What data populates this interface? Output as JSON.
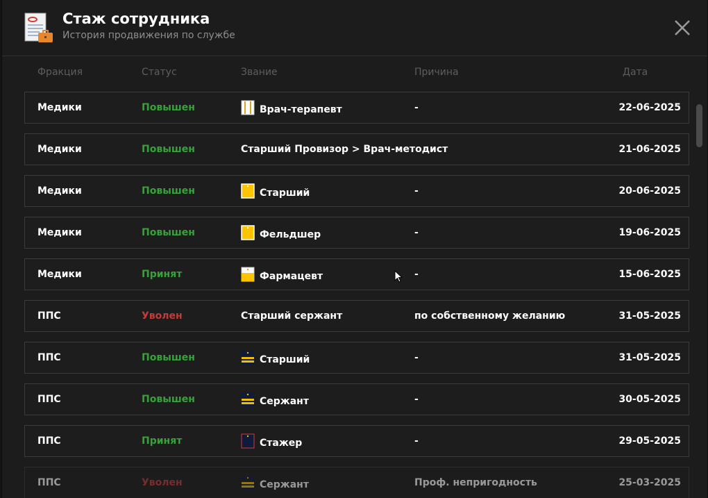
{
  "header": {
    "title": "Стаж сотрудника",
    "subtitle": "История продвижения по службе"
  },
  "columns": {
    "faction": "Фракция",
    "status": "Статус",
    "rank": "Звание",
    "reason": "Причина",
    "date": "Дата"
  },
  "rows": [
    {
      "faction": "Медики",
      "status": "Повышен",
      "status_type": "up",
      "rank": "Врач-терапевт",
      "rank_icon": "medic-white",
      "reason": "-",
      "date": "22-06-2025"
    },
    {
      "faction": "Медики",
      "status": "Повышен",
      "status_type": "up",
      "rank": "Старший Провизор > Врач-методист",
      "rank_icon": "",
      "reason": "",
      "date": "21-06-2025"
    },
    {
      "faction": "Медики",
      "status": "Повышен",
      "status_type": "up",
      "rank": "Старший",
      "rank_icon": "medic-yellow",
      "reason": "-",
      "date": "20-06-2025"
    },
    {
      "faction": "Медики",
      "status": "Повышен",
      "status_type": "up",
      "rank": "Фельдшер",
      "rank_icon": "medic-yellow",
      "reason": "-",
      "date": "19-06-2025"
    },
    {
      "faction": "Медики",
      "status": "Принят",
      "status_type": "up",
      "rank": "Фармацевт",
      "rank_icon": "medic-yellow-white",
      "reason": "-",
      "date": "15-06-2025"
    },
    {
      "faction": "ППС",
      "status": "Уволен",
      "status_type": "fired",
      "rank": "Старший сержант",
      "rank_icon": "",
      "reason": "по собственному желанию",
      "date": "31-05-2025"
    },
    {
      "faction": "ППС",
      "status": "Повышен",
      "status_type": "up",
      "rank": "Старший",
      "rank_icon": "police-stripes",
      "reason": "-",
      "date": "31-05-2025"
    },
    {
      "faction": "ППС",
      "status": "Повышен",
      "status_type": "up",
      "rank": "Сержант",
      "rank_icon": "police-stripes",
      "reason": "-",
      "date": "30-05-2025"
    },
    {
      "faction": "ППС",
      "status": "Принят",
      "status_type": "up",
      "rank": "Стажер",
      "rank_icon": "police-plain",
      "reason": "-",
      "date": "29-05-2025"
    },
    {
      "faction": "ППС",
      "status": "Уволен",
      "status_type": "fired",
      "rank": "Сержант",
      "rank_icon": "police-stripes",
      "reason": "Проф. непригодность",
      "date": "25-03-2025"
    }
  ],
  "colors": {
    "status_up": "#36a33a",
    "status_fired": "#c43b3b",
    "background": "#1c1c1c",
    "row_border": "#3b3b3b"
  },
  "icons": {
    "app": "document-briefcase-icon",
    "close": "close-icon"
  }
}
